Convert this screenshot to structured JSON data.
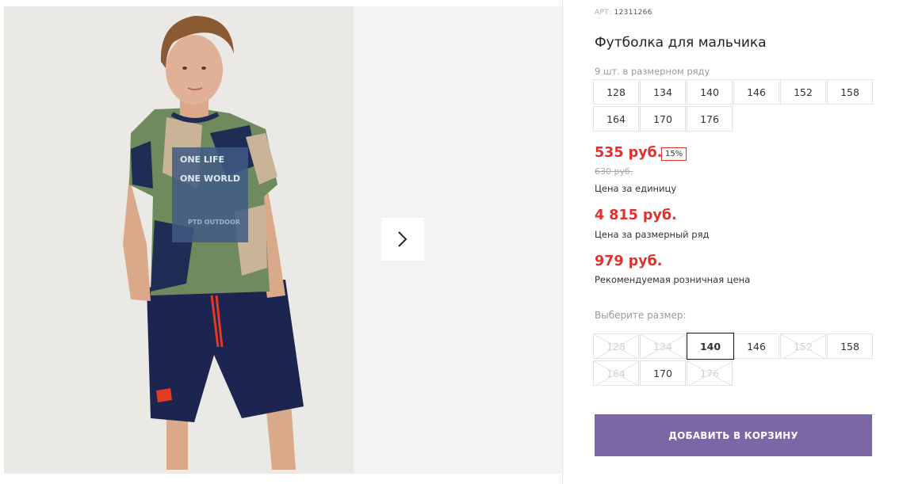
{
  "product": {
    "art_label": "АРТ:",
    "art_number": "12311266",
    "title": "Футболка для мальчика",
    "row_info": "9 шт. в размерном ряду"
  },
  "size_row": [
    "128",
    "134",
    "140",
    "146",
    "152",
    "158",
    "164",
    "170",
    "176"
  ],
  "prices": {
    "unit_price": "535 руб.",
    "discount": "15%",
    "old_price": "630 руб.",
    "unit_caption": "Цена за единицу",
    "row_price": "4 815 руб.",
    "row_caption": "Цена за размерный ряд",
    "retail_price": "979 руб.",
    "retail_caption": "Рекомендуемая розничная цена"
  },
  "size_choice": {
    "label": "Выберите размер:",
    "options": [
      {
        "size": "128",
        "state": "unavailable"
      },
      {
        "size": "134",
        "state": "unavailable"
      },
      {
        "size": "140",
        "state": "selected"
      },
      {
        "size": "146",
        "state": "available"
      },
      {
        "size": "152",
        "state": "unavailable"
      },
      {
        "size": "158",
        "state": "available"
      },
      {
        "size": "164",
        "state": "unavailable"
      },
      {
        "size": "170",
        "state": "available"
      },
      {
        "size": "176",
        "state": "unavailable"
      }
    ]
  },
  "cart_button_label": "ДОБАВИТЬ В КОРЗИНУ",
  "colors": {
    "price": "#e1312f",
    "cart_button": "#7b67a5",
    "shirt_green": "#6f8a5c",
    "shirt_navy": "#1f2d55",
    "shorts": "#1c2450"
  },
  "icons": {
    "next": "chevron-right-icon"
  }
}
